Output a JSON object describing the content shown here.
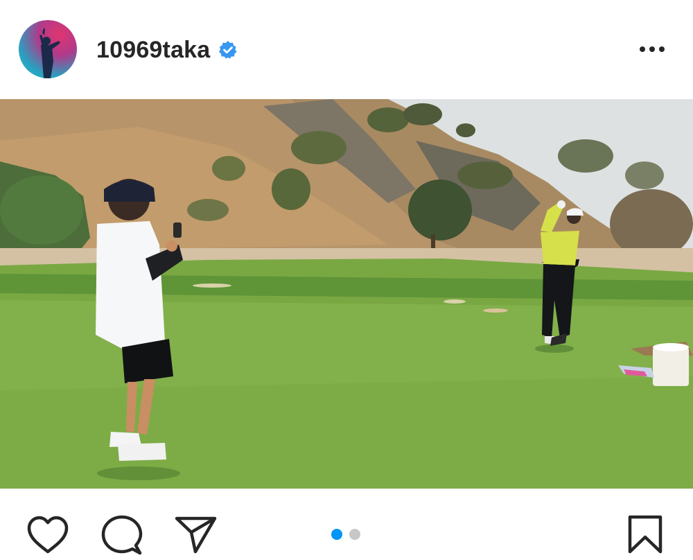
{
  "post": {
    "username": "10969taka",
    "verified": true,
    "avatar": "avatar-golfer-silhouette",
    "menu_icon": "more-horizontal-icon"
  },
  "media": {
    "description_icon": "golf-course-photo",
    "carousel_count": 2,
    "carousel_active_index": 0
  },
  "actions": {
    "like_icon": "heart-icon",
    "comment_icon": "comment-icon",
    "share_icon": "send-icon",
    "save_icon": "bookmark-icon"
  },
  "colors": {
    "text": "#262626",
    "verified_blue": "#3897f0",
    "dot_active": "#0095f6",
    "dot_inactive": "#c7c7c7"
  }
}
